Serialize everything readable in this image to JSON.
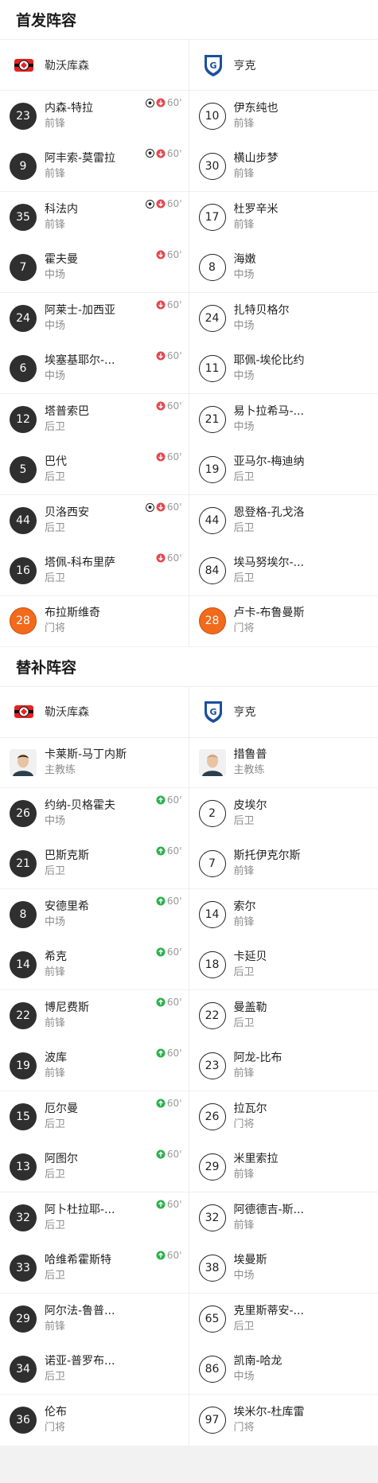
{
  "sections": {
    "starting_title": "首发阵容",
    "subs_title": "替补阵容"
  },
  "teams": {
    "home": "勒沃库森",
    "away": "亨克"
  },
  "starting": {
    "home": [
      {
        "num": "23",
        "name": "内森-特拉",
        "pos": "前锋",
        "ball": true,
        "sub": "out",
        "min": "60'"
      },
      {
        "num": "9",
        "name": "阿丰索-莫雷拉",
        "pos": "前锋",
        "ball": true,
        "sub": "out",
        "min": "60'"
      },
      {
        "num": "35",
        "name": "科法内",
        "pos": "前锋",
        "ball": true,
        "sub": "out",
        "min": "60'"
      },
      {
        "num": "7",
        "name": "霍夫曼",
        "pos": "中场",
        "ball": false,
        "sub": "out",
        "min": "60'"
      },
      {
        "num": "24",
        "name": "阿莱士-加西亚",
        "pos": "中场",
        "ball": false,
        "sub": "out",
        "min": "60'"
      },
      {
        "num": "6",
        "name": "埃塞基耶尔-...",
        "pos": "中场",
        "ball": false,
        "sub": "out",
        "min": "60'"
      },
      {
        "num": "12",
        "name": "塔普索巴",
        "pos": "后卫",
        "ball": false,
        "sub": "out",
        "min": "60'"
      },
      {
        "num": "5",
        "name": "巴代",
        "pos": "后卫",
        "ball": false,
        "sub": "out",
        "min": "60'"
      },
      {
        "num": "44",
        "name": "贝洛西安",
        "pos": "后卫",
        "ball": true,
        "sub": "out",
        "min": "60'"
      },
      {
        "num": "16",
        "name": "塔佩-科布里萨",
        "pos": "后卫",
        "ball": false,
        "sub": "out",
        "min": "60'"
      },
      {
        "num": "28",
        "name": "布拉斯维奇",
        "pos": "门将",
        "ball": false,
        "sub": "",
        "min": "",
        "gk": true
      }
    ],
    "away": [
      {
        "num": "10",
        "name": "伊东纯也",
        "pos": "前锋"
      },
      {
        "num": "30",
        "name": "横山步梦",
        "pos": "前锋"
      },
      {
        "num": "17",
        "name": "杜罗辛米",
        "pos": "前锋"
      },
      {
        "num": "8",
        "name": "海嫩",
        "pos": "中场"
      },
      {
        "num": "24",
        "name": "扎特贝格尔",
        "pos": "中场"
      },
      {
        "num": "11",
        "name": "耶佩-埃伦比约",
        "pos": "中场"
      },
      {
        "num": "21",
        "name": "易卜拉希马-...",
        "pos": "中场"
      },
      {
        "num": "19",
        "name": "亚马尔-梅迪纳",
        "pos": "后卫"
      },
      {
        "num": "44",
        "name": "恩登格-孔戈洛",
        "pos": "后卫"
      },
      {
        "num": "84",
        "name": "埃马努埃尔-...",
        "pos": "后卫"
      },
      {
        "num": "28",
        "name": "卢卡-布鲁曼斯",
        "pos": "门将",
        "gk": true
      }
    ]
  },
  "subs": {
    "home_coach": {
      "name": "卡莱斯-马丁内斯",
      "pos": "主教练"
    },
    "away_coach": {
      "name": "措鲁普",
      "pos": "主教练"
    },
    "home": [
      {
        "num": "26",
        "name": "约纳-贝格霍夫",
        "pos": "中场",
        "sub": "in",
        "min": "60'"
      },
      {
        "num": "21",
        "name": "巴斯克斯",
        "pos": "后卫",
        "sub": "in",
        "min": "60'"
      },
      {
        "num": "8",
        "name": "安德里希",
        "pos": "中场",
        "sub": "in",
        "min": "60'"
      },
      {
        "num": "14",
        "name": "希克",
        "pos": "前锋",
        "sub": "in",
        "min": "60'"
      },
      {
        "num": "22",
        "name": "博尼费斯",
        "pos": "前锋",
        "sub": "in",
        "min": "60'"
      },
      {
        "num": "19",
        "name": "波库",
        "pos": "前锋",
        "sub": "in",
        "min": "60'"
      },
      {
        "num": "15",
        "name": "厄尔曼",
        "pos": "后卫",
        "sub": "in",
        "min": "60'"
      },
      {
        "num": "13",
        "name": "阿图尔",
        "pos": "后卫",
        "sub": "in",
        "min": "60'"
      },
      {
        "num": "32",
        "name": "阿卜杜拉耶-...",
        "pos": "后卫",
        "sub": "in",
        "min": "60'"
      },
      {
        "num": "33",
        "name": "哈维希霍斯特",
        "pos": "后卫",
        "sub": "in",
        "min": "60'"
      },
      {
        "num": "29",
        "name": "阿尔法-鲁普...",
        "pos": "前锋",
        "sub": "",
        "min": ""
      },
      {
        "num": "34",
        "name": "诺亚-普罗布...",
        "pos": "后卫",
        "sub": "",
        "min": ""
      },
      {
        "num": "36",
        "name": "伦布",
        "pos": "门将",
        "sub": "",
        "min": ""
      }
    ],
    "away": [
      {
        "num": "2",
        "name": "皮埃尔",
        "pos": "后卫"
      },
      {
        "num": "7",
        "name": "斯托伊克尔斯",
        "pos": "前锋"
      },
      {
        "num": "14",
        "name": "索尔",
        "pos": "前锋"
      },
      {
        "num": "18",
        "name": "卡延贝",
        "pos": "后卫"
      },
      {
        "num": "22",
        "name": "曼盖勒",
        "pos": "后卫"
      },
      {
        "num": "23",
        "name": "阿龙-比布",
        "pos": "前锋"
      },
      {
        "num": "26",
        "name": "拉瓦尔",
        "pos": "门将"
      },
      {
        "num": "29",
        "name": "米里索拉",
        "pos": "前锋"
      },
      {
        "num": "32",
        "name": "阿德德吉-斯...",
        "pos": "前锋"
      },
      {
        "num": "38",
        "name": "埃曼斯",
        "pos": "中场"
      },
      {
        "num": "65",
        "name": "克里斯蒂安-...",
        "pos": "后卫"
      },
      {
        "num": "86",
        "name": "凯南-哈龙",
        "pos": "中场"
      },
      {
        "num": "97",
        "name": "埃米尔-杜库雷",
        "pos": "门将"
      }
    ]
  },
  "colors": {
    "sub_out": "#e5484d",
    "sub_in": "#2bb24c",
    "goalkeeper": "#f26a1b"
  }
}
